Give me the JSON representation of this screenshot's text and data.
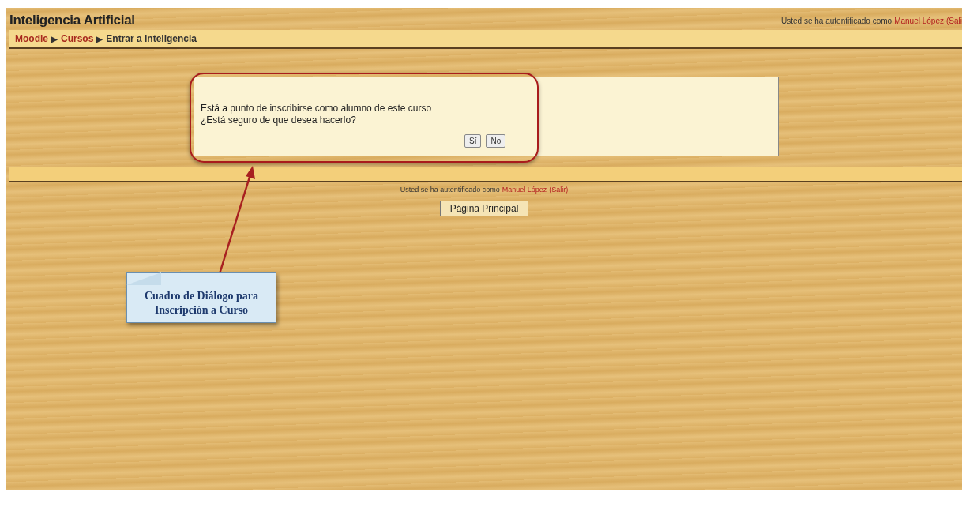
{
  "header": {
    "title": "Inteligencia Artificial",
    "login": {
      "prefix": "Usted se ha autentificado como",
      "user": "Manuel López",
      "logout": "(Sali"
    }
  },
  "breadcrumb": [
    {
      "kind": "link",
      "label": "Moodle"
    },
    {
      "kind": "separator",
      "label": "▶"
    },
    {
      "kind": "link",
      "label": "Cursos"
    },
    {
      "kind": "separator",
      "label": "▶"
    },
    {
      "kind": "current",
      "label": "Entrar a Inteligencia"
    }
  ],
  "dialog": {
    "lines": [
      "Está a punto de inscribirse como alumno de este curso",
      "¿Está seguro de que desea hacerlo?"
    ],
    "buttons": [
      "Sí",
      "No"
    ]
  },
  "footer": {
    "login": {
      "prefix": "Usted se ha autentificado como",
      "user": "Manuel López",
      "logout": "(Salir)"
    },
    "home_button": "Página Principal"
  },
  "annotation": {
    "callout": "Cuadro de Diálogo para Inscripción a Curso"
  }
}
